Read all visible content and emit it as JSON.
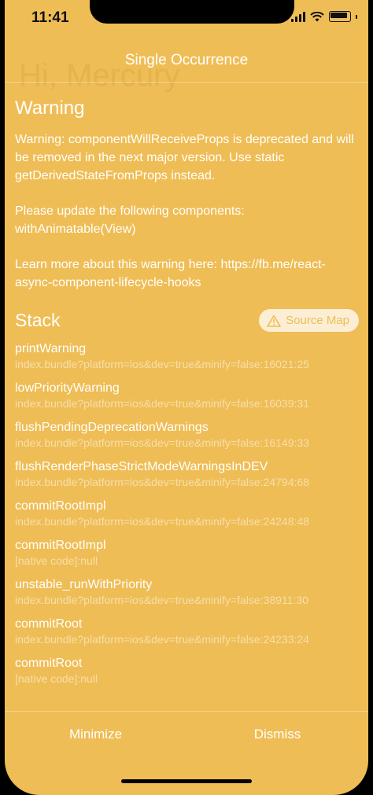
{
  "status_bar": {
    "time": "11:41"
  },
  "background": {
    "greeting": "Hi, Mercury"
  },
  "header": {
    "title": "Single Occurrence"
  },
  "warning": {
    "title": "Warning",
    "paragraphs": [
      "Warning: componentWillReceiveProps is deprecated and will be removed in the next major version. Use static getDerivedStateFromProps instead.",
      "Please update the following components: withAnimatable(View)",
      "Learn more about this warning here: https://fb.me/react-async-component-lifecycle-hooks"
    ]
  },
  "stack": {
    "title": "Stack",
    "source_map_label": "Source Map",
    "frames": [
      {
        "name": "printWarning",
        "location": "index.bundle?platform=ios&dev=true&minify=false:16021:25"
      },
      {
        "name": "lowPriorityWarning",
        "location": "index.bundle?platform=ios&dev=true&minify=false:16039:31"
      },
      {
        "name": "flushPendingDeprecationWarnings",
        "location": "index.bundle?platform=ios&dev=true&minify=false:16149:33"
      },
      {
        "name": "flushRenderPhaseStrictModeWarningsInDEV",
        "location": "index.bundle?platform=ios&dev=true&minify=false:24794:68"
      },
      {
        "name": "commitRootImpl",
        "location": "index.bundle?platform=ios&dev=true&minify=false:24248:48"
      },
      {
        "name": "commitRootImpl",
        "location": "[native code]:null"
      },
      {
        "name": "unstable_runWithPriority",
        "location": "index.bundle?platform=ios&dev=true&minify=false:38911:30"
      },
      {
        "name": "commitRoot",
        "location": "index.bundle?platform=ios&dev=true&minify=false:24233:24"
      },
      {
        "name": "commitRoot",
        "location": "[native code]:null"
      }
    ]
  },
  "footer": {
    "minimize_label": "Minimize",
    "dismiss_label": "Dismiss"
  },
  "colors": {
    "background": "#efbd55",
    "text": "#ffffff"
  },
  "icons": {
    "source_map": "warning-triangle-icon"
  }
}
